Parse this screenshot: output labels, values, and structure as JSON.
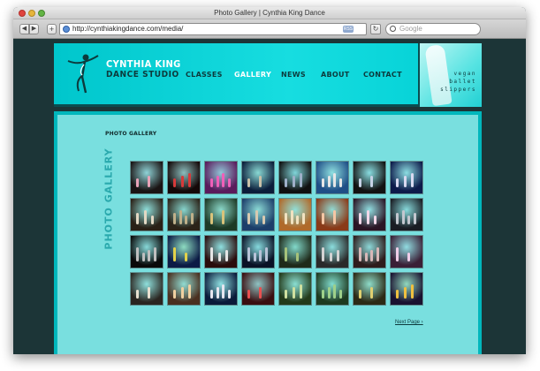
{
  "window": {
    "title": "Photo Gallery | Cynthia King Dance"
  },
  "toolbar": {
    "back_label": "◀",
    "forward_label": "▶",
    "add_label": "+",
    "url": "http://cynthiakingdance.com/media/",
    "rss_label": "RSS",
    "reload_label": "↻",
    "search_placeholder": "Google"
  },
  "site": {
    "logo_name": "CYNTHIA KING",
    "logo_sub": "DANCE STUDIO",
    "nav": [
      {
        "label": "CLASSES",
        "active": false
      },
      {
        "label": "GALLERY",
        "active": true
      },
      {
        "label": "NEWS",
        "active": false
      },
      {
        "label": "ABOUT",
        "active": false
      },
      {
        "label": "CONTACT",
        "active": false
      }
    ],
    "slipper_lines": [
      "vegan",
      "ballet",
      "slippers"
    ]
  },
  "gallery": {
    "heading": "PHOTO GALLERY",
    "vertical_label": "PHOTO GALLERY",
    "next_link": "Next Page ›",
    "rows": [
      [
        {
          "bg": "#1a1414",
          "fig": "#e9a3b8"
        },
        {
          "bg": "#140808",
          "fig": "#d63a3a"
        },
        {
          "bg": "#5a1b5c",
          "fig": "#f05fb8"
        },
        {
          "bg": "#0b1d3a",
          "fig": "#c9c0a8"
        },
        {
          "bg": "#101010",
          "fig": "#9fb0c8"
        },
        {
          "bg": "#1f4e86",
          "fig": "#e6e6e6"
        },
        {
          "bg": "#121212",
          "fig": "#c7d3e6"
        },
        {
          "bg": "#0d1a4a",
          "fig": "#d9d9f0"
        }
      ],
      [
        {
          "bg": "#2a2016",
          "fig": "#e3d8c4"
        },
        {
          "bg": "#2b2318",
          "fig": "#bfb08a"
        },
        {
          "bg": "#1d3a26",
          "fig": "#d9c37a"
        },
        {
          "bg": "#1c3e6a",
          "fig": "#d8c9b0"
        },
        {
          "bg": "#b06a2a",
          "fig": "#f1e2c0"
        },
        {
          "bg": "#8a3a18",
          "fig": "#f5c6a4"
        },
        {
          "bg": "#2b1525",
          "fig": "#f2d7e8"
        },
        {
          "bg": "#1a1d24",
          "fig": "#c3c7cf"
        }
      ],
      [
        {
          "bg": "#0a0a0a",
          "fig": "#bfbfbf"
        },
        {
          "bg": "#0c1b45",
          "fig": "#e2d24a"
        },
        {
          "bg": "#2a0c0c",
          "fig": "#e5e5e5"
        },
        {
          "bg": "#0a1226",
          "fig": "#b8c3d8"
        },
        {
          "bg": "#1f2a1a",
          "fig": "#a6c27a"
        },
        {
          "bg": "#2a2a2a",
          "fig": "#d3d3d3"
        },
        {
          "bg": "#2e1c1c",
          "fig": "#d8b8b8"
        },
        {
          "bg": "#3a1f36",
          "fig": "#f0cde8"
        }
      ],
      [
        {
          "bg": "#2a2520",
          "fig": "#e8e0d0"
        },
        {
          "bg": "#4a3020",
          "fig": "#f0d0a0"
        },
        {
          "bg": "#0a1a3a",
          "fig": "#e6e6f0"
        },
        {
          "bg": "#3a0e10",
          "fig": "#e85050"
        },
        {
          "bg": "#233a1a",
          "fig": "#cfe0a0"
        },
        {
          "bg": "#1e3a20",
          "fig": "#9fd08a"
        },
        {
          "bg": "#2c2a16",
          "fig": "#e0d070"
        },
        {
          "bg": "#1a1230",
          "fig": "#f0c040"
        }
      ]
    ]
  }
}
